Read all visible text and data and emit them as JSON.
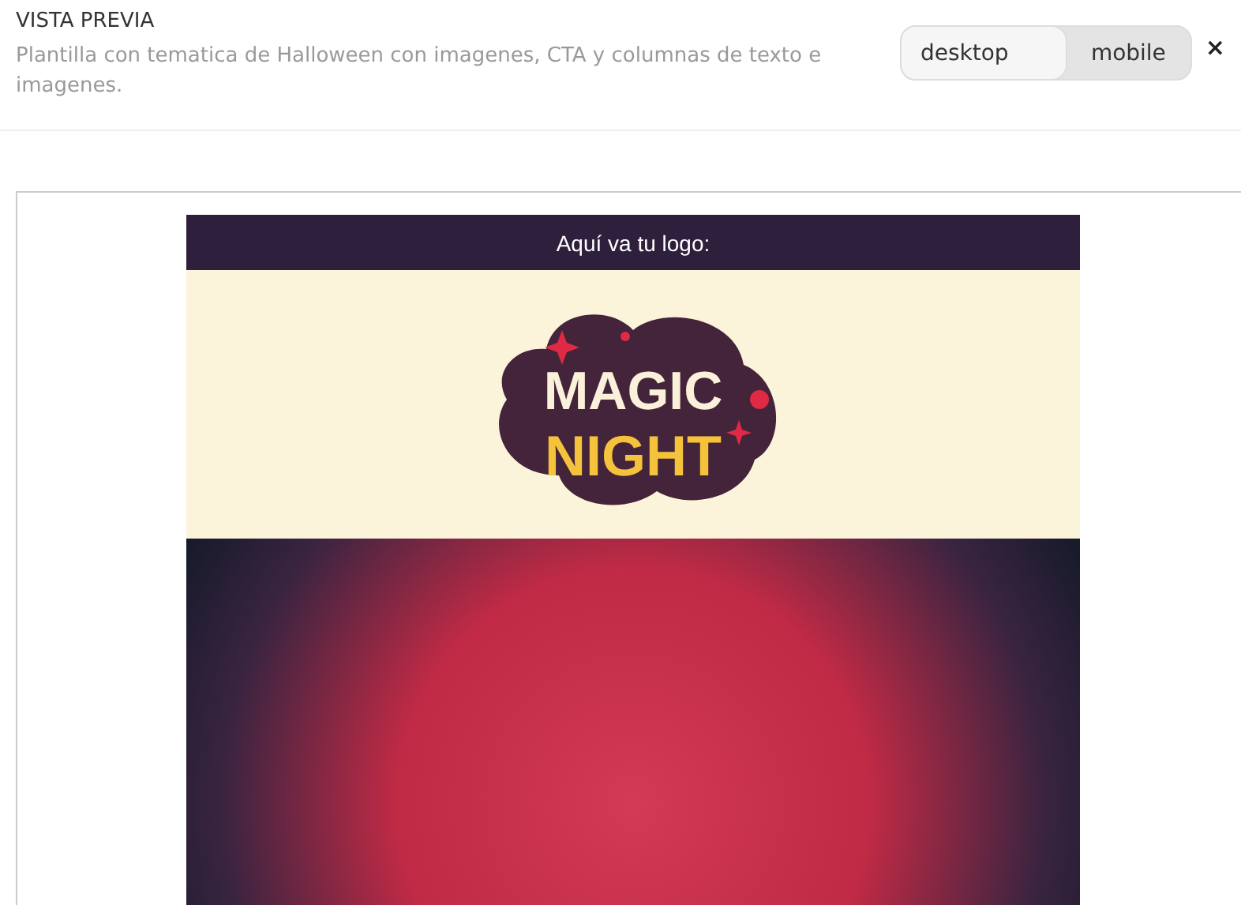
{
  "header": {
    "title": "VISTA PREVIA",
    "description": "Plantilla con tematica de Halloween con imagenes, CTA y columnas de texto e imagenes.",
    "view_modes": [
      {
        "label": "desktop",
        "selected": true
      },
      {
        "label": "mobile",
        "selected": false
      }
    ],
    "close": "×"
  },
  "email": {
    "logo_bar": "Aquí va tu logo:",
    "logo": {
      "line_1": "MAGIC",
      "line_2": "NIGHT"
    }
  }
}
